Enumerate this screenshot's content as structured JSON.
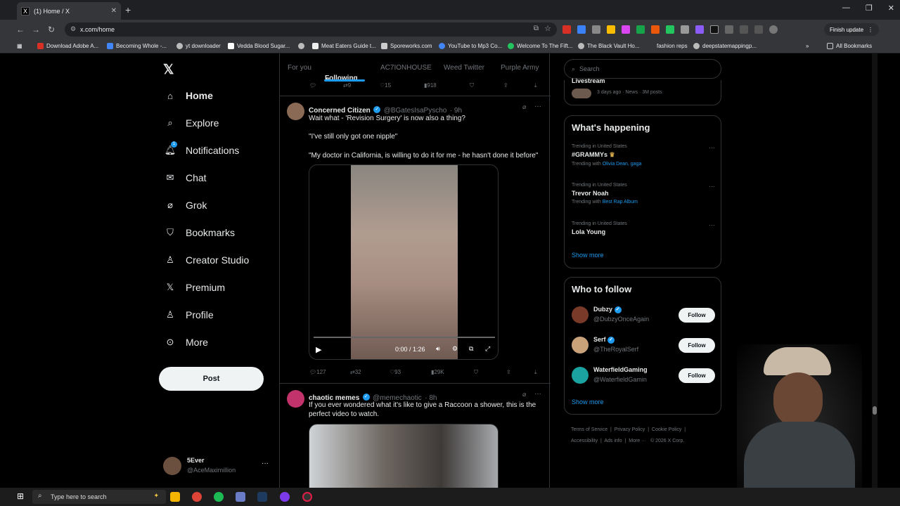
{
  "browser": {
    "tab_title": "(1) Home / X",
    "url": "x.com/home",
    "finish_update": "Finish update",
    "bookmarks": [
      "Download Adobe A...",
      "Becoming Whole -...",
      "yt downloader",
      "Vedda Blood Sugar...",
      "Meat Eaters Guide t...",
      "Sporeworks.com",
      "YouTube to Mp3 Co...",
      "Welcome To The Fift...",
      "The Black Vault Ho...",
      "fashion reps",
      "deepstatemappingp..."
    ],
    "all_bookmarks": "All Bookmarks"
  },
  "nav": {
    "items": [
      "Home",
      "Explore",
      "Notifications",
      "Chat",
      "Grok",
      "Bookmarks",
      "Creator Studio",
      "Premium",
      "Profile",
      "More"
    ],
    "notifications_badge": "1",
    "post_label": "Post",
    "user_name": "5Ever",
    "user_handle": "@AceMaximillion"
  },
  "feed": {
    "tabs": [
      "For you",
      "Following",
      "AC7IONHOUSE",
      "Weed Twitter",
      "Purple Army"
    ],
    "top_actions": {
      "retweets": "9",
      "likes": "15",
      "views": "918"
    },
    "tweet1": {
      "name": "Concerned Citizen",
      "handle": "@BGatesIsaPyscho",
      "time": "· 9h",
      "line1": "Wait what - 'Revision Surgery' is now also a thing?",
      "line2": "\"I've still only got one nipple\"",
      "line3": "\"My doctor in California, is willing to do it for me - he hasn't done it before\"",
      "video_time": "0:00 / 1:26",
      "replies": "127",
      "retweets": "32",
      "likes": "93",
      "views": "29K"
    },
    "tweet2": {
      "name": "chaotic memes",
      "handle": "@memechaotic",
      "time": "· 8h",
      "text": "If you ever wondered what it's like to give a Raccoon a shower, this is the perfect video to watch."
    }
  },
  "right": {
    "search_placeholder": "Search",
    "livestream_title": "Livestream",
    "livestream_meta": "3 days ago · News · 3M posts",
    "whats_happening": "What's happening",
    "trends": [
      {
        "context": "Trending in United States",
        "title": "#GRAMMYs",
        "with_label": "Trending with",
        "with": "Olivia Dean, gaga"
      },
      {
        "context": "Trending in United States",
        "title": "Trevor Noah",
        "with_label": "Trending with",
        "with": "Best Rap Album"
      },
      {
        "context": "Trending in United States",
        "title": "Lola Young",
        "with_label": "",
        "with": ""
      }
    ],
    "show_more": "Show more",
    "who_to_follow": "Who to follow",
    "follow": [
      {
        "name": "Dubzy",
        "handle": "@DubzyOnceAgain",
        "button": "Follow"
      },
      {
        "name": "Serf",
        "handle": "@TheRoyalSerf",
        "button": "Follow"
      },
      {
        "name": "WaterfieldGaming",
        "handle": "@WaterfieldGamin",
        "button": "Follow"
      }
    ],
    "footer": [
      "Terms of Service",
      "Privacy Policy",
      "Cookie Policy",
      "Accessibility",
      "Ads info",
      "More ···",
      "© 2026 X Corp."
    ]
  },
  "taskbar": {
    "search_placeholder": "Type here to search"
  },
  "colors": {
    "accent": "#1d9bf0",
    "background": "#000000",
    "chrome": "#35363a"
  }
}
